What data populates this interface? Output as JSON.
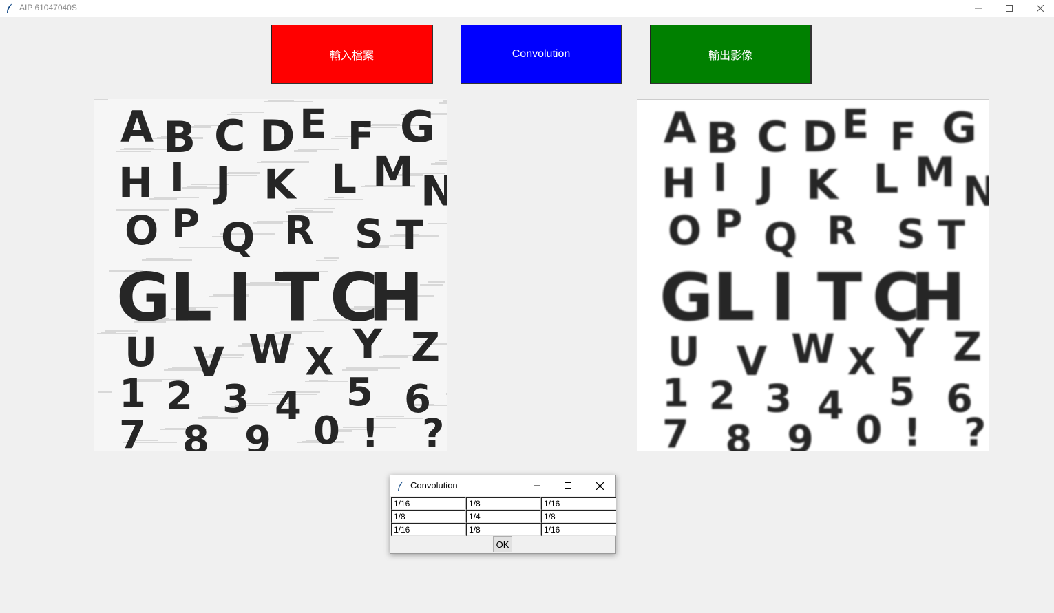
{
  "window": {
    "title": "AIP 61047040S"
  },
  "toolbar": {
    "input_label": "輸入檔案",
    "convolution_label": "Convolution",
    "output_label": "輸出影像",
    "input_color": "#ff0000",
    "convolution_color": "#0000ff",
    "output_color": "#008000"
  },
  "images": {
    "letters": "ABCDEFGHIJKLMNOPQRSTGLITCHUVWXYZ1234567890!?7"
  },
  "dialog": {
    "title": "Convolution",
    "kernel": [
      [
        "1/16",
        "1/8",
        "1/16"
      ],
      [
        "1/8",
        "1/4",
        "1/8"
      ],
      [
        "1/16",
        "1/8",
        "1/16"
      ]
    ],
    "ok_label": "OK"
  }
}
